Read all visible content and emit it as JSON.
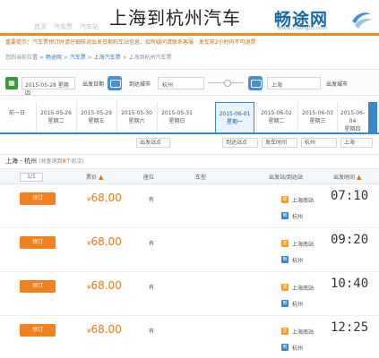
{
  "overlay_title": "上海到杭州汽车",
  "header": {
    "tabs": [
      "首页",
      "汽车票",
      "汽车站"
    ],
    "logo_text": "畅途网",
    "logo_url": "www.changtu.com"
  },
  "notice": "重要提示：汽车票预订时请仔细核对出发日期和车站信息，如有疑问请联系客服 · 发车前2小时内不可退票",
  "breadcrumb": {
    "items": [
      "您的当前位置",
      "畅途网",
      "汽车票",
      "上海汽车票",
      "上海到杭州汽车票"
    ],
    "sep": " > "
  },
  "search": {
    "date_value": "2015-05-28",
    "date_suffix": "星期四",
    "from_label": "出发城市",
    "from_value": "上海",
    "to_label": "到达城市",
    "to_value": "杭州",
    "date_label": "出发日期",
    "date2_value": "2015-05-28",
    "date2_suffix": "星期四"
  },
  "dates": {
    "prev_label": "前一日",
    "days": [
      {
        "date": "2015-05-26",
        "week": "星期二"
      },
      {
        "date": "2015-05-29",
        "week": "星期五"
      },
      {
        "date": "2015-05-30",
        "week": "星期六"
      },
      {
        "date": "2015-05-31",
        "week": "星期日"
      },
      {
        "date": "2015-06-01",
        "week": "星期一"
      },
      {
        "date": "2015-06-02",
        "week": "星期二"
      },
      {
        "date": "2015-06-03",
        "week": "星期三"
      },
      {
        "date": "2015-06-04",
        "week": "星期四"
      }
    ]
  },
  "filters": {
    "left": [
      "上海",
      "杭州"
    ],
    "mid": [
      "出发站点",
      "到达站点",
      "发车时间"
    ]
  },
  "route": {
    "from": "上海",
    "to": "杭州",
    "count_prefix": "(共查询到",
    "count": "8",
    "count_suffix": "个班次)"
  },
  "table": {
    "pager": "1/1",
    "headers": {
      "price": "票价",
      "seat": "座位",
      "type": "车型",
      "station": "出发站/到达站",
      "time": "出发时间"
    }
  },
  "rows": [
    {
      "book": "预订",
      "price": "68.00",
      "currency": "¥",
      "seat": "有",
      "from": "上海南站",
      "to": "杭州",
      "time": "07:10"
    },
    {
      "book": "预订",
      "price": "68.00",
      "currency": "¥",
      "seat": "有",
      "from": "上海南站",
      "to": "杭州",
      "time": "09:20"
    },
    {
      "book": "预订",
      "price": "68.00",
      "currency": "¥",
      "seat": "有",
      "from": "上海南站",
      "to": "杭州",
      "time": "10:40"
    },
    {
      "book": "预订",
      "price": "68.00",
      "currency": "¥",
      "seat": "有",
      "from": "上海南站",
      "to": "杭州",
      "time": "12:25"
    }
  ],
  "colors": {
    "accent_orange": "#f08020",
    "accent_blue": "#3a86c8",
    "price": "#f07a14"
  }
}
